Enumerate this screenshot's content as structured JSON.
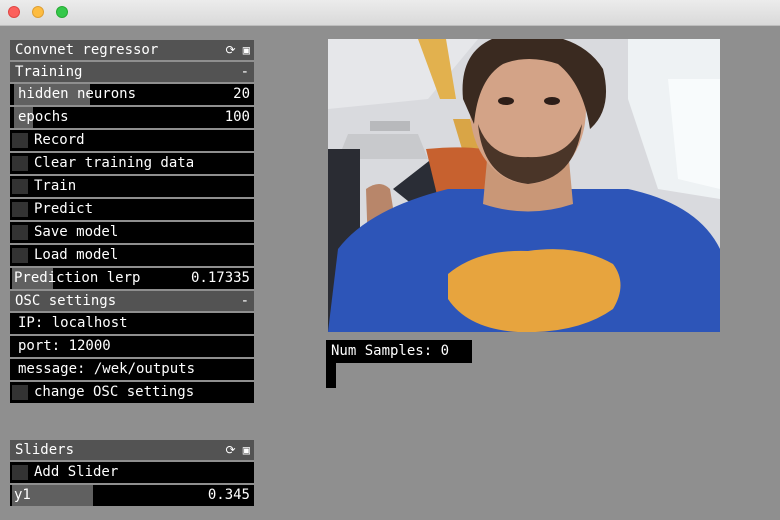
{
  "panels": {
    "convnet": {
      "title": "Convnet regressor"
    },
    "training": {
      "title": "Training",
      "collapse": "-",
      "hidden_neurons": {
        "label": "hidden neurons",
        "value": "20",
        "fraction": 0.32
      },
      "epochs": {
        "label": "epochs",
        "value": "100",
        "fraction": 0.08
      },
      "toggles": [
        "Record",
        "Clear training data",
        "Train",
        "Predict",
        "Save model",
        "Load model"
      ],
      "prediction_lerp": {
        "label": "Prediction lerp",
        "value": "0.17335",
        "fraction": 0.17335
      }
    },
    "osc": {
      "title": "OSC settings",
      "collapse": "-",
      "ip": "IP: localhost",
      "port": "port: 12000",
      "message": "message: /wek/outputs",
      "change": "change OSC settings"
    },
    "sliders": {
      "title": "Sliders",
      "add": "Add Slider",
      "y1": {
        "label": "y1",
        "value": "0.345",
        "fraction": 0.345
      }
    }
  },
  "camera": {
    "num_samples": "Num Samples: 0"
  }
}
